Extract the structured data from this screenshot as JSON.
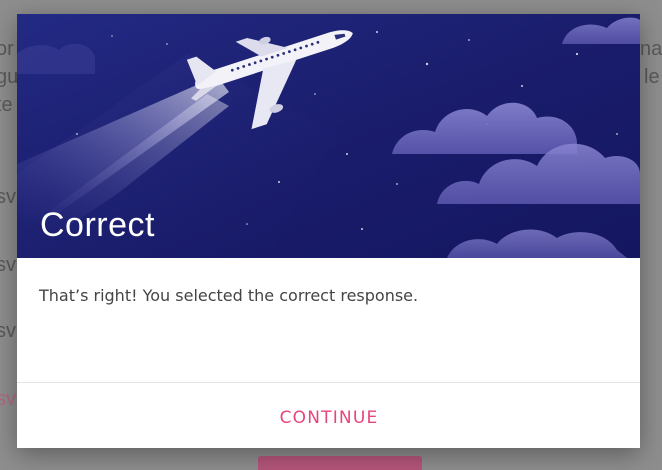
{
  "dialog": {
    "title": "Correct",
    "message": "That’s right!  You selected the correct response.",
    "continue_label": "CONTINUE"
  },
  "colors": {
    "accent": "#e5457e",
    "hero_background": "#1b1f6e",
    "overlay": "#8e8e8e"
  }
}
